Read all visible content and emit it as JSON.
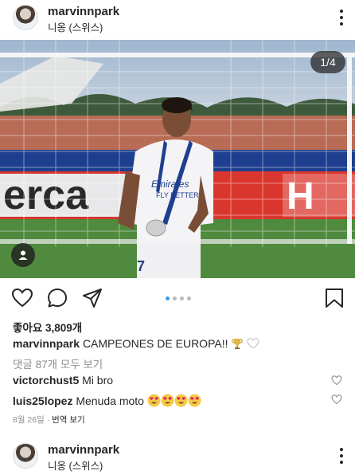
{
  "post": {
    "username": "marvinnpark",
    "location": "니옹 (스위스)",
    "carousel_counter": "1/4",
    "carousel": {
      "total": 4,
      "current": 1
    },
    "likes": "좋아요 3,809개",
    "caption_user": "marvinnpark",
    "caption_text": "CAMPEONES DE EUROPA!!",
    "caption_emoji": [
      "trophy",
      "white-heart"
    ],
    "view_all_comments": "댓글 87개 모두 보기",
    "comments": [
      {
        "user": "victorchust5",
        "text": "Mi bro"
      },
      {
        "user": "luis25lopez",
        "text": "Menuda moto",
        "emoji_count": 4
      }
    ],
    "date": "8월 26일",
    "see_translation": "번역 보기"
  },
  "next_post": {
    "username": "marvinnpark",
    "location": "니옹 (스위스)"
  },
  "icons": [
    "more-options-icon",
    "user-tag-icon",
    "heart-icon",
    "comment-icon",
    "share-icon",
    "save-icon"
  ],
  "colors": {
    "dot_active": "#3897f0",
    "dot_inactive": "#b9b9b9",
    "secondary_text": "#8e8e8e"
  }
}
